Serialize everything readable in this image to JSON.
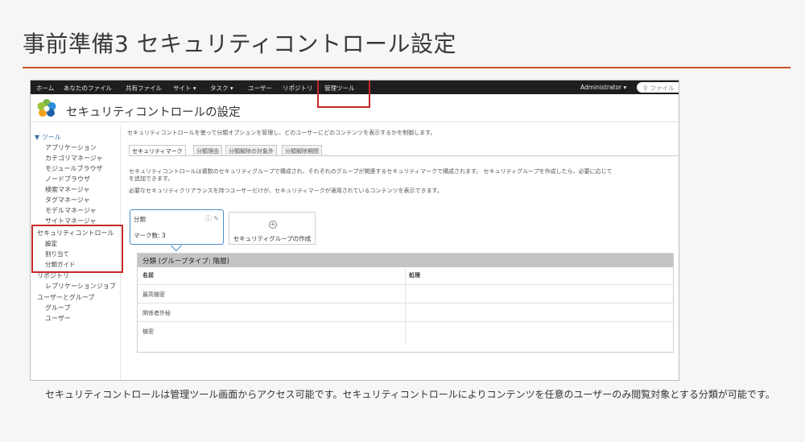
{
  "slide": {
    "title": "事前準備3 セキュリティコントロール設定",
    "caption": "セキュリティコントロールは管理ツール画面からアクセス可能です。セキュリティコントロールによりコンテンツを任意のユーザーのみ閲覧対象とする分類が可能です。",
    "accent_color": "#c9502a",
    "highlight_color": "#c62828"
  },
  "navbar": {
    "items": [
      "ホーム",
      "あなたのファイル",
      "共有ファイル",
      "サイト ▾",
      "タスク ▾",
      "ユーザー",
      "リポジトリ",
      "管理ツール"
    ],
    "user": "Administrator ▾",
    "search_placeholder": "ファイル"
  },
  "header": {
    "title": "セキュリティコントロールの設定",
    "logo_icon": "alfresco-flower-logo"
  },
  "sidebar": {
    "items": [
      "▼ ツール",
      "アプリケーション",
      "カテゴリマネージャ",
      "モジュールブラウザ",
      "ノードブラウザ",
      "検索マネージャ",
      "タグマネージャ",
      "モデルマネージャ",
      "サイトマネージャ",
      "セキュリティコントロール",
      "設定",
      "割り当て",
      "分類ガイド",
      "リポジトリ",
      "レプリケーションジョブ",
      "ユーザーとグループ",
      "グループ",
      "ユーザー"
    ]
  },
  "main": {
    "description": "セキュリティコントロールを使って分類オプションを管理し、どのユーザーにどのコンテンツを表示するかを制御します。",
    "tabs": [
      "セキュリティマーク",
      "分類理由",
      "分類解除の対象外",
      "分類解除期間"
    ],
    "para1": "セキュリティコントロールは複数のセキュリティグループで構成され、それぞれのグループが関連するセキュリティマークで構成されます。 セキュリティグループを作成したら、必要に応じて",
    "para2": "を追加できます。",
    "para3": "必要なセキュリティクリアランスを持つユーザーだけが、セキュリティマークが適用されているコンテンツを表示できます。",
    "group_card": {
      "title": "分類",
      "count_label": "マーク数: 3",
      "icons": "ⓘ ✎"
    },
    "add_group": {
      "icon": "+",
      "label": "セキュリティグループの作成"
    },
    "panel": {
      "title": "分類 (グループタイプ: 階層)",
      "col_name": "名前",
      "col_action": "処理",
      "rows": [
        "最高機密",
        "関係者外秘",
        "機密"
      ]
    }
  }
}
